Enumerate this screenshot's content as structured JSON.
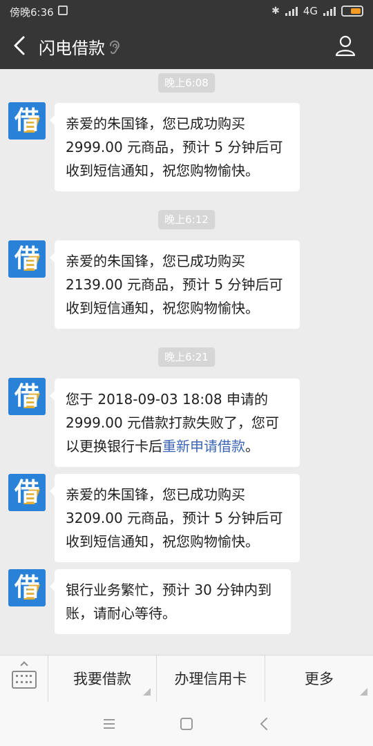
{
  "status_bar": {
    "time": "傍晚6:36",
    "network": "4G",
    "icons": [
      "notification-icon",
      "bluetooth-icon",
      "signal-icon",
      "signal-icon",
      "battery-icon"
    ]
  },
  "header": {
    "title": "闪电借款",
    "back_icon": "back-arrow-icon",
    "ear_icon": "ear-mode-icon",
    "user_icon": "user-profile-icon"
  },
  "avatar": {
    "char": "借",
    "color": "#2a82d8"
  },
  "messages": [
    {
      "time": "晚上6:08",
      "text_lines": [
        "亲爱的朱国锋，您已成功购买",
        "2999.00 元商品，预计 5 分钟后可",
        "收到短信通知，祝您购物愉快。"
      ]
    },
    {
      "time": "晚上6:12",
      "text_lines": [
        "亲爱的朱国锋，您已成功购买",
        "2139.00 元商品，预计 5 分钟后可",
        "收到短信通知，祝您购物愉快。"
      ]
    },
    {
      "time": "晚上6:21",
      "text_lines": [
        "您于 2018-09-03 18:08 申请的",
        "2999.00 元借款打款失败了，您可"
      ],
      "line3_prefix": "以更换银行卡后",
      "line3_link": "重新申请借款",
      "line3_suffix": "。"
    },
    {
      "text_lines": [
        "亲爱的朱国锋，您已成功购买",
        "3209.00 元商品，预计 5 分钟后可",
        "收到短信通知，祝您购物愉快。"
      ]
    },
    {
      "text_lines": [
        "银行业务繁忙，预计 30 分钟内到",
        "账，请耐心等待。"
      ]
    }
  ],
  "menu": {
    "keyboard_icon": "keyboard-icon",
    "items": [
      {
        "label": "我要借款"
      },
      {
        "label": "办理信用卡"
      },
      {
        "label": "更多"
      }
    ]
  },
  "system_nav": [
    "menu-icon",
    "home-icon",
    "back-icon"
  ],
  "colors": {
    "accent": "#2a82d8",
    "link": "#3b66b5",
    "header_bg": "#363636",
    "battery": "#f59a23"
  }
}
